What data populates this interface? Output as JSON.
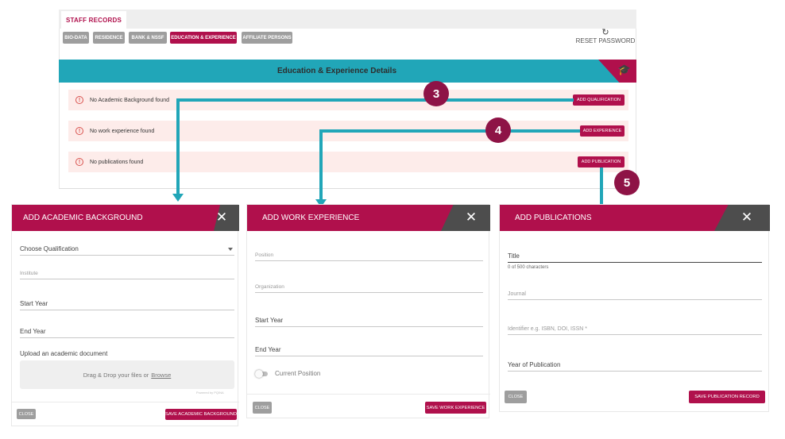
{
  "staff": {
    "tab_label": "STAFF RECORDS",
    "chips": [
      "BIO-DATA",
      "RESIDENCE",
      "BANK & NSSF",
      "EDUCATION & EXPERIENCE",
      "AFFILIATE PERSONS"
    ],
    "reset_label": "RESET PASSWORD",
    "section_title": "Education & Experience Details",
    "rows": [
      {
        "message": "No Academic Background found",
        "button": "ADD QUALIFICATION"
      },
      {
        "message": "No work experience found",
        "button": "ADD EXPERIENCE"
      },
      {
        "message": "No publications found",
        "button": "ADD PUBLICATION"
      }
    ]
  },
  "steps": [
    "3",
    "4",
    "5"
  ],
  "academic": {
    "title": "ADD ACADEMIC BACKGROUND",
    "qualification_label": "Choose Qualification",
    "institute_label": "Institute",
    "start_label": "Start Year",
    "end_label": "End Year",
    "upload_label": "Upload an academic document",
    "drop_text": "Drag & Drop your files or",
    "browse_link": "Browse",
    "powered_by": "Powered by PQINA",
    "close_label": "CLOSE",
    "save_label": "SAVE ACADEMIC BACKGROUND"
  },
  "work": {
    "title": "ADD WORK EXPERIENCE",
    "position_label": "Position",
    "organization_label": "Organization",
    "start_label": "Start Year",
    "end_label": "End Year",
    "current_label": "Current Position",
    "close_label": "CLOSE",
    "save_label": "SAVE WORK EXPERIENCE"
  },
  "publications": {
    "title": "ADD PUBLICATIONS",
    "title_label": "Title",
    "char_count": "0 of 500 characters",
    "journal_label": "Journal",
    "identifier_label": "Identifier e.g. ISBN, DOI, ISSN *",
    "year_label": "Year of Publication",
    "close_label": "CLOSE",
    "save_label": "SAVE PUBLICATION RECORD"
  },
  "colors": {
    "brand": "#b0104c",
    "teal": "#21a6b8",
    "step": "#8e1346"
  }
}
